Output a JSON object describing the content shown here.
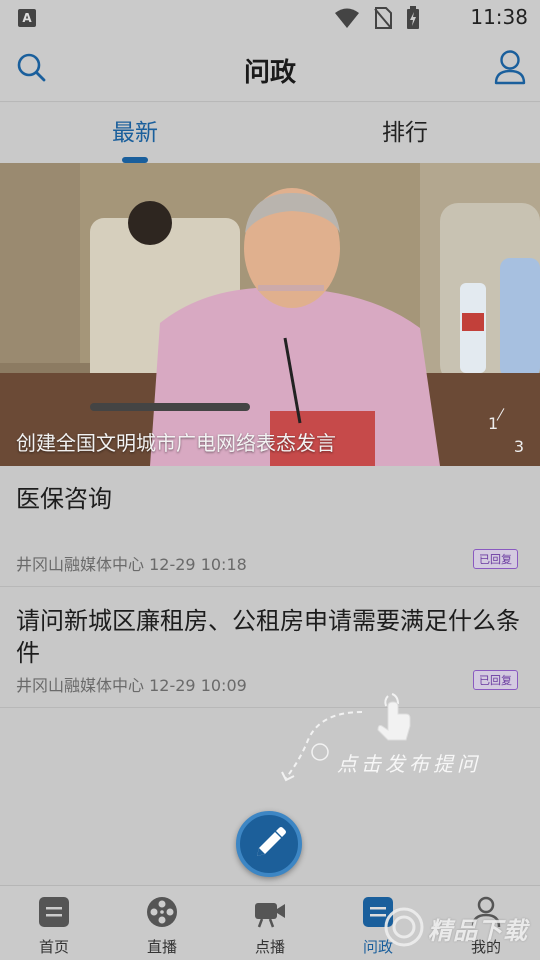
{
  "status_bar": {
    "time": "11:38",
    "notification_icon": "A"
  },
  "header": {
    "title": "问政"
  },
  "tabs": [
    {
      "label": "最新",
      "active": true
    },
    {
      "label": "排行",
      "active": false
    }
  ],
  "banner": {
    "caption": "创建全国文明城市广电网络表态发言",
    "page_current": "1",
    "page_total": "3"
  },
  "questions": [
    {
      "title": "医保咨询",
      "source": "井冈山融媒体中心",
      "time": "12-29 10:18",
      "status": "已回复"
    },
    {
      "title": "请问新城区廉租房、公租房申请需要满足什么条件",
      "source": "井冈山融媒体中心",
      "time": "12-29 10:09",
      "status": "已回复"
    }
  ],
  "hint": {
    "text": "点击发布提问"
  },
  "bottom_nav": [
    {
      "label": "首页",
      "icon": "home-doc-icon",
      "active": false
    },
    {
      "label": "直播",
      "icon": "film-reel-icon",
      "active": false
    },
    {
      "label": "点播",
      "icon": "video-camera-icon",
      "active": false
    },
    {
      "label": "问政",
      "icon": "question-doc-icon",
      "active": true
    },
    {
      "label": "我的",
      "icon": "user-icon",
      "active": false
    }
  ],
  "watermark": {
    "text": "精品下载"
  },
  "colors": {
    "accent": "#1a5f9c",
    "badge": "#6a3aa0"
  }
}
